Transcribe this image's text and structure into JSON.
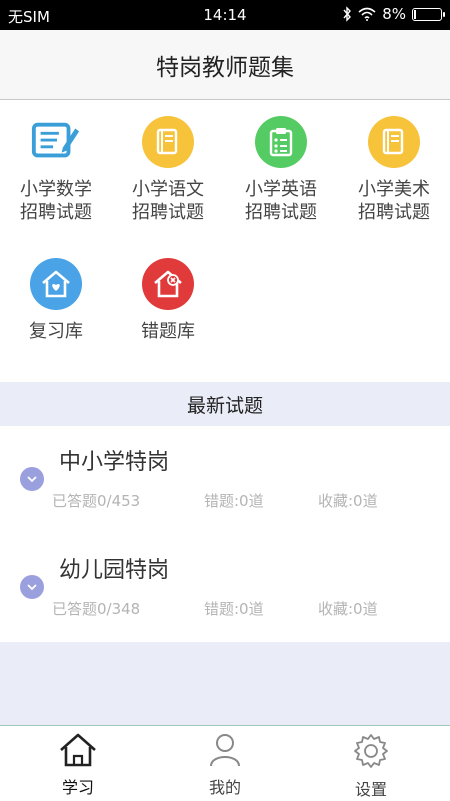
{
  "status_bar": {
    "carrier": "无SIM",
    "time": "14:14",
    "battery": "8%",
    "battery_level": 0.08
  },
  "header": {
    "title": "特岗教师题集"
  },
  "categories": [
    {
      "label": "小学数学招聘试题",
      "icon": "edit-document-icon",
      "color": "#3a9fd8"
    },
    {
      "label": "小学语文招聘试题",
      "icon": "book-icon",
      "color": "#f6c33b"
    },
    {
      "label": "小学英语招聘试题",
      "icon": "clipboard-icon",
      "color": "#55cc63"
    },
    {
      "label": "小学美术招聘试题",
      "icon": "book-icon",
      "color": "#f6c33b"
    },
    {
      "label": "复习库",
      "icon": "home-heart-icon",
      "color": "#4aa3e6"
    },
    {
      "label": "错题库",
      "icon": "home-x-icon",
      "color": "#e03a3a"
    }
  ],
  "section": {
    "title": "最新试题"
  },
  "exams": [
    {
      "title": "中小学特岗",
      "answered": "已答题0/453",
      "wrong": "错题:0道",
      "favorites": "收藏:0道"
    },
    {
      "title": "幼儿园特岗",
      "answered": "已答题0/348",
      "wrong": "错题:0道",
      "favorites": "收藏:0道"
    }
  ],
  "tabs": [
    {
      "label": "学习",
      "icon": "home-icon",
      "active": true
    },
    {
      "label": "我的",
      "icon": "user-icon",
      "active": false
    },
    {
      "label": "设置",
      "icon": "gear-icon",
      "active": false
    }
  ]
}
